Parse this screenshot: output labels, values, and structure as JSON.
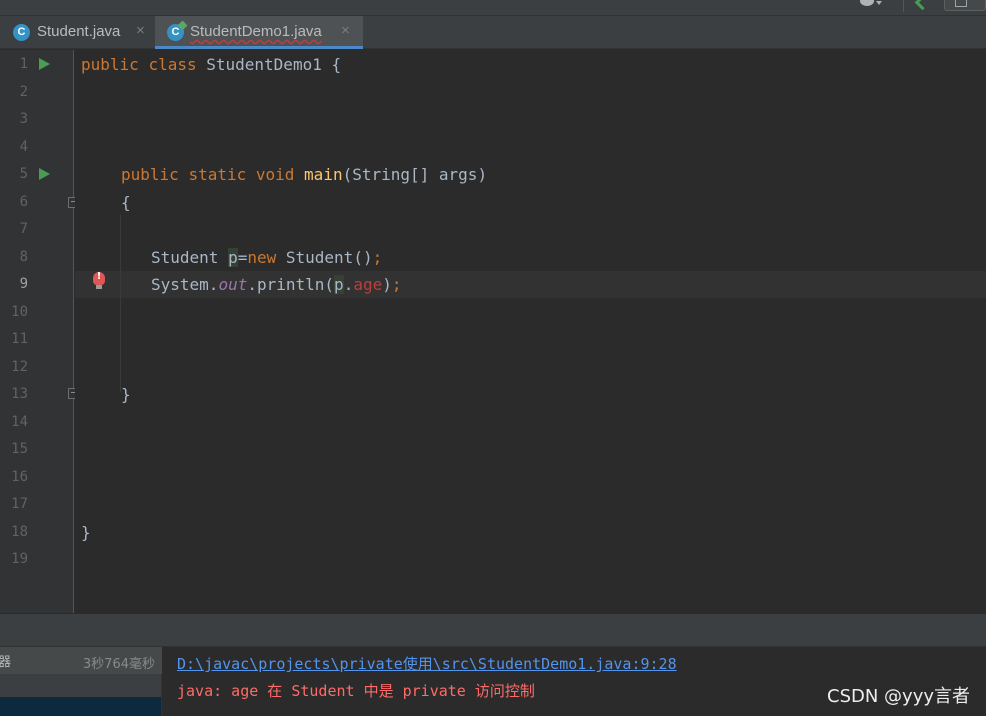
{
  "tabs": [
    {
      "icon": "java-class-icon",
      "icon_letter": "C",
      "label": "Student.java",
      "close": "×"
    },
    {
      "icon": "java-class-icon",
      "icon_letter": "C",
      "label": "StudentDemo1.java",
      "close": "×"
    }
  ],
  "editor": {
    "line_numbers": [
      "1",
      "2",
      "3",
      "4",
      "5",
      "6",
      "7",
      "8",
      "9",
      "10",
      "11",
      "12",
      "13",
      "14",
      "15",
      "16",
      "17",
      "18",
      "19"
    ],
    "current_line": "9",
    "code": {
      "l1": {
        "kw1": "public",
        "kw2": "class",
        "rest": " StudentDemo1 {"
      },
      "l5": {
        "kw1": "public",
        "kw2": "static",
        "kw3": "void",
        "fn": "main",
        "rest": "(String[] args)"
      },
      "l6": "{",
      "l8": {
        "a": "Student ",
        "var": "p",
        "b": "=",
        "kw": "new",
        "c": " Student()",
        "semi": ";"
      },
      "l9": {
        "a": "System.",
        "field": "out",
        "b": ".println(",
        "var": "p",
        "c": ".",
        "err": "age",
        "d": ")",
        "semi": ";"
      },
      "l13": "}",
      "l18": "}"
    }
  },
  "build": {
    "tree_fragment": "器",
    "elapsed": "3秒764毫秒"
  },
  "output": {
    "path_link": "D:\\javac\\projects\\private使用\\src\\StudentDemo1.java:9:28",
    "error_message": "java: age 在 Student 中是 private 访问控制"
  },
  "watermark": "CSDN @yyy言者",
  "colors": {
    "keyword": "#cc7832",
    "function": "#ffc66d",
    "static_field": "#9876aa",
    "error": "#ff6b68",
    "link": "#5394ec"
  }
}
